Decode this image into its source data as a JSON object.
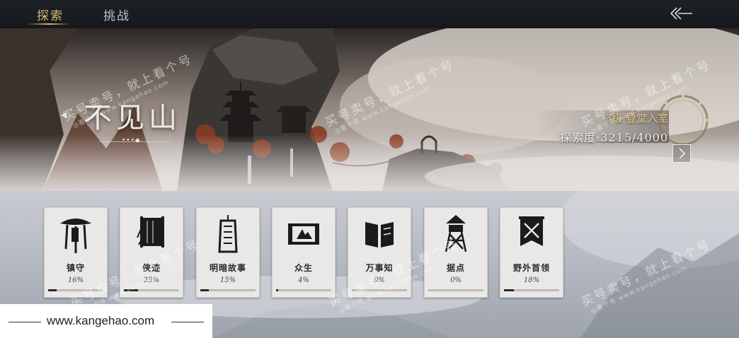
{
  "tabs": [
    {
      "label": "探索",
      "active": true
    },
    {
      "label": "挑战",
      "active": false
    }
  ],
  "back_icon": "double-chevron-left-icon",
  "region": {
    "title": "不见山",
    "page_dots": "•••◆",
    "stage": "3级·登堂入室",
    "progress": "探索度·3215/4000"
  },
  "enter_icon": "chevron-right-icon",
  "cards": [
    {
      "name": "镇守",
      "percent": "16%",
      "value": 16,
      "icon": "bamboo-hat-icon"
    },
    {
      "name": "侠迹",
      "percent": "25%",
      "value": 25,
      "icon": "scroll-bamboo-icon"
    },
    {
      "name": "明暗故事",
      "percent": "15%",
      "value": 15,
      "icon": "hanging-scroll-icon"
    },
    {
      "name": "众生",
      "percent": "4%",
      "value": 4,
      "icon": "painting-scroll-icon"
    },
    {
      "name": "万事知",
      "percent": "0%",
      "value": 0,
      "icon": "open-book-icon"
    },
    {
      "name": "据点",
      "percent": "0%",
      "value": 0,
      "icon": "watchtower-icon"
    },
    {
      "name": "野外首领",
      "percent": "18%",
      "value": 18,
      "icon": "crossed-swords-banner-icon"
    }
  ],
  "watermark": {
    "main": "买号卖号，就上看个号",
    "sub": "◎看个号 www.kangehao.com"
  },
  "site": "www.kangehao.com",
  "colors": {
    "accent": "#d9b77a",
    "stage_gold": "#e8c78b"
  }
}
